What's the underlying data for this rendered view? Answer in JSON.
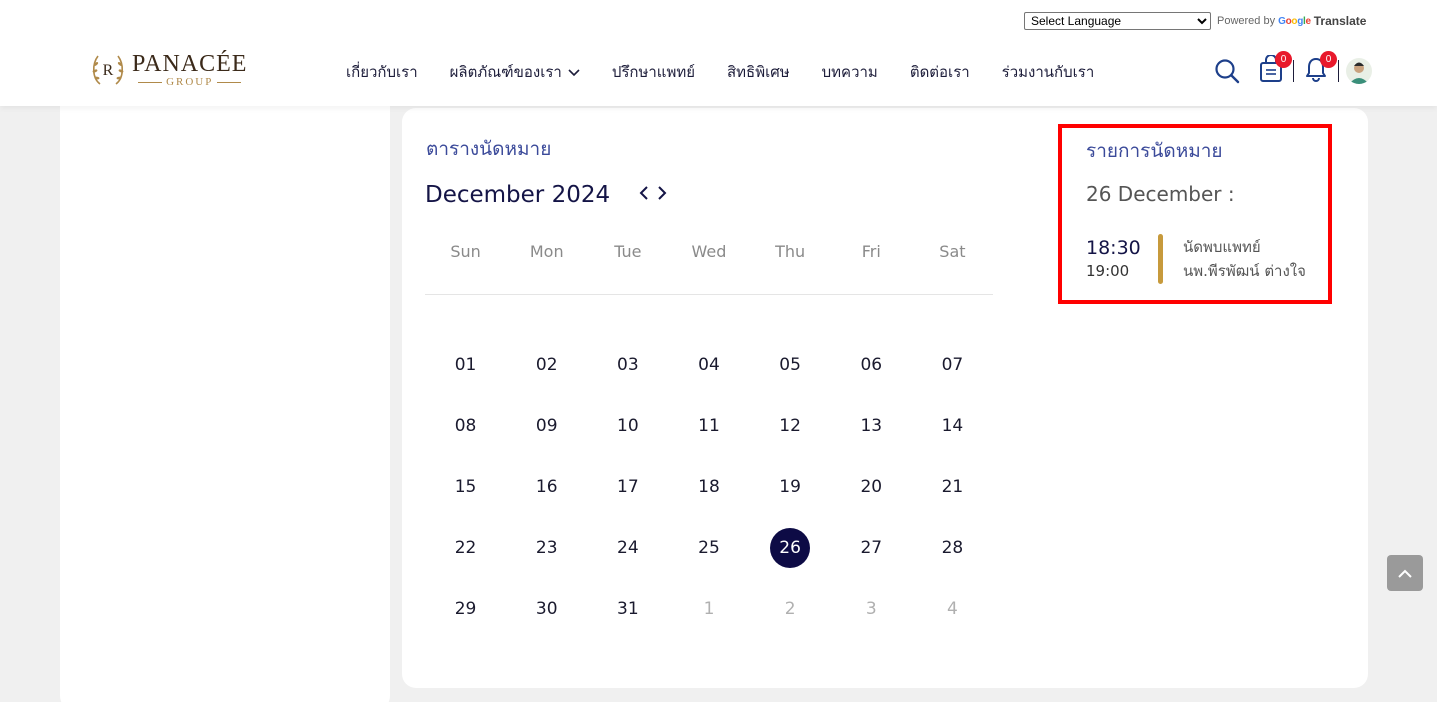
{
  "header": {
    "translate": {
      "select_value": "Select Language",
      "powered_by": "Powered by",
      "google": "Google",
      "translate_label": "Translate"
    },
    "logo": {
      "brand": "PANACÉE",
      "group": "GROUP",
      "crest_letter": "R"
    },
    "nav": [
      {
        "label": "เกี่ยวกับเรา"
      },
      {
        "label": "ผลิตภัณฑ์ของเรา",
        "has_dropdown": true
      },
      {
        "label": "ปรึกษาแพทย์"
      },
      {
        "label": "สิทธิพิเศษ"
      },
      {
        "label": "บทความ"
      },
      {
        "label": "ติดต่อเรา"
      },
      {
        "label": "ร่วมงานกับเรา"
      }
    ],
    "cart_count": "0",
    "notification_count": "0",
    "accent_color": "#1d3f8a"
  },
  "calendar": {
    "title": "ตารางนัดหมาย",
    "month": "December 2024",
    "weekdays": [
      "Sun",
      "Mon",
      "Tue",
      "Wed",
      "Thu",
      "Fri",
      "Sat"
    ],
    "days": [
      [
        "01",
        "02",
        "03",
        "04",
        "05",
        "06",
        "07"
      ],
      [
        "08",
        "09",
        "10",
        "11",
        "12",
        "13",
        "14"
      ],
      [
        "15",
        "16",
        "17",
        "18",
        "19",
        "20",
        "21"
      ],
      [
        "22",
        "23",
        "24",
        "25",
        "26",
        "27",
        "28"
      ],
      [
        "29",
        "30",
        "31",
        "1",
        "2",
        "3",
        "4"
      ]
    ],
    "selected_day": "26",
    "selected_color": "#0d0b45"
  },
  "appointments": {
    "title": "รายการนัดหมาย",
    "date": "26 December :",
    "items": [
      {
        "start": "18:30",
        "end": "19:00",
        "type": "นัดพบแพทย์",
        "doctor": "นพ.พีรพัฒน์ ต่างใจ"
      }
    ],
    "bar_color": "#c79a3c"
  }
}
